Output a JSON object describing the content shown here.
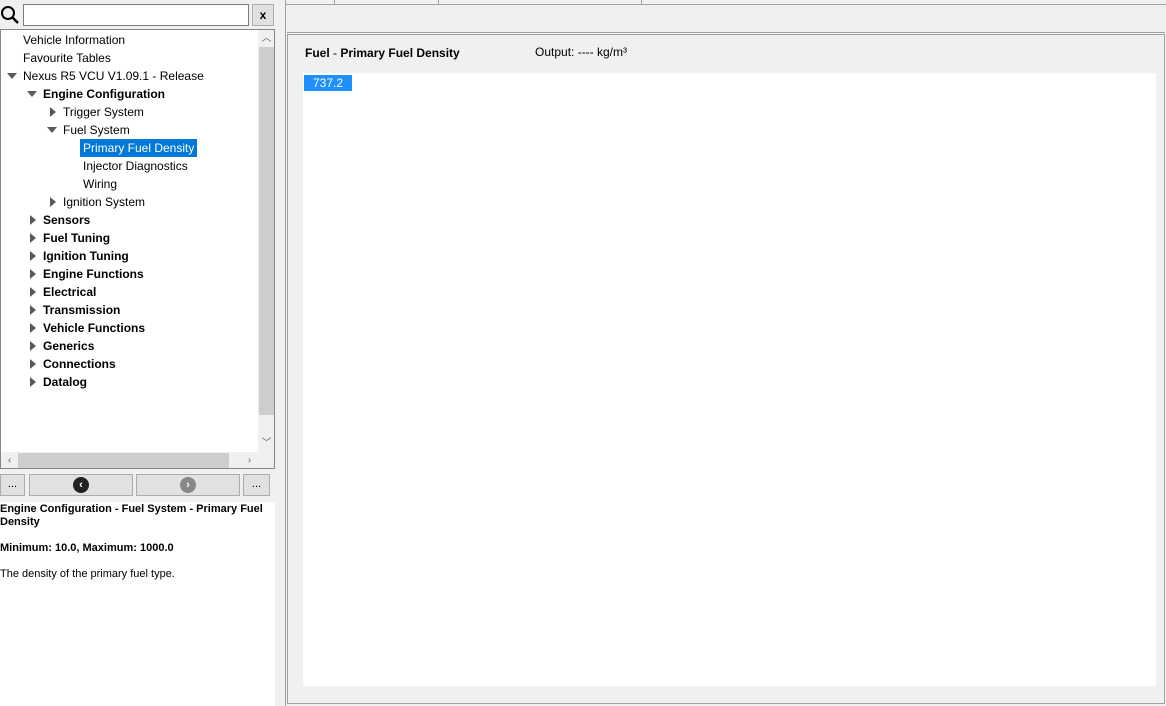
{
  "search": {
    "value": "",
    "clear_label": "x"
  },
  "tree": {
    "items": [
      {
        "label": "Vehicle Information",
        "bold": false,
        "expander": "none",
        "selected": false
      },
      {
        "label": "Favourite Tables",
        "bold": false,
        "expander": "none",
        "selected": false
      },
      {
        "label": "Nexus R5 VCU V1.09.1 - Release",
        "bold": false,
        "expander": "expanded",
        "selected": false
      },
      {
        "label": "Engine Configuration",
        "bold": true,
        "expander": "expanded",
        "selected": false
      },
      {
        "label": "Trigger System",
        "bold": false,
        "expander": "collapsed",
        "selected": false
      },
      {
        "label": "Fuel System",
        "bold": false,
        "expander": "expanded",
        "selected": false
      },
      {
        "label": "Primary Fuel Density",
        "bold": false,
        "expander": "none",
        "selected": true
      },
      {
        "label": "Injector Diagnostics",
        "bold": false,
        "expander": "none",
        "selected": false
      },
      {
        "label": "Wiring",
        "bold": false,
        "expander": "none",
        "selected": false
      },
      {
        "label": "Ignition System",
        "bold": false,
        "expander": "collapsed",
        "selected": false
      },
      {
        "label": "Sensors",
        "bold": true,
        "expander": "collapsed",
        "selected": false
      },
      {
        "label": "Fuel Tuning",
        "bold": true,
        "expander": "collapsed",
        "selected": false
      },
      {
        "label": "Ignition Tuning",
        "bold": true,
        "expander": "collapsed",
        "selected": false
      },
      {
        "label": "Engine Functions",
        "bold": true,
        "expander": "collapsed",
        "selected": false
      },
      {
        "label": "Electrical",
        "bold": true,
        "expander": "collapsed",
        "selected": false
      },
      {
        "label": "Transmission",
        "bold": true,
        "expander": "collapsed",
        "selected": false
      },
      {
        "label": "Vehicle Functions",
        "bold": true,
        "expander": "collapsed",
        "selected": false
      },
      {
        "label": "Generics",
        "bold": true,
        "expander": "collapsed",
        "selected": false
      },
      {
        "label": "Connections",
        "bold": true,
        "expander": "collapsed",
        "selected": false
      },
      {
        "label": "Datalog",
        "bold": true,
        "expander": "collapsed",
        "selected": false
      }
    ]
  },
  "nav": {
    "more_left_label": "...",
    "more_right_label": "...",
    "back_icon": "chevron-left-circle-icon",
    "forward_icon": "chevron-right-circle-icon"
  },
  "help": {
    "title": "Engine Configuration - Fuel System - Primary Fuel Density",
    "range": "Minimum: 10.0, Maximum: 1000.0",
    "description": "The density of the primary fuel type."
  },
  "table": {
    "title_category": "Fuel",
    "title_separator": " - ",
    "title_name": "Primary Fuel Density",
    "output_text": "Output: ---- kg/m³",
    "value": "737.2"
  },
  "colors": {
    "selection": "#0078d7",
    "value_cell": "#1e90ff"
  }
}
